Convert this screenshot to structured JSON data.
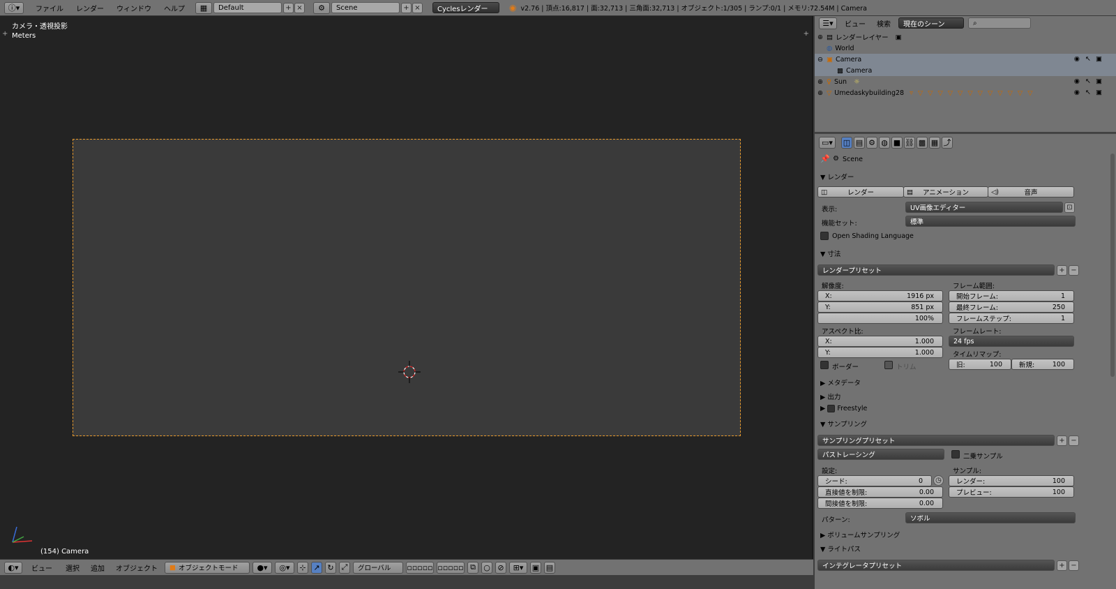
{
  "topbar": {
    "menus": [
      "ファイル",
      "レンダー",
      "ウィンドウ",
      "ヘルプ"
    ],
    "screen_layout": "Default",
    "scene": "Scene",
    "engine": "Cyclesレンダー",
    "stats": "v2.76 | 頂点:16,817 | 面:32,713 | 三角面:32,713 | オブジェクト:1/305 | ランプ:0/1 | メモリ:72.54M | Camera"
  },
  "viewport": {
    "view_name": "カメラ・透視投影",
    "units": "Meters",
    "frame_info": "(154) Camera",
    "menus": [
      "ビュー",
      "選択",
      "追加",
      "オブジェクト"
    ],
    "mode": "オブジェクトモード",
    "orientation": "グローバル",
    "accent": "#e89a2c"
  },
  "outliner": {
    "menus": [
      "ビュー",
      "検索"
    ],
    "display_mode": "現在のシーン",
    "search_placeholder": "",
    "items": [
      {
        "label": "レンダーレイヤー",
        "indent": 0
      },
      {
        "label": "World",
        "indent": 0
      },
      {
        "label": "Camera",
        "indent": 0,
        "selected": true
      },
      {
        "label": "Camera",
        "indent": 1,
        "selected": true
      },
      {
        "label": "Sun",
        "indent": 0
      },
      {
        "label": "Umedaskybuilding28",
        "indent": 0
      }
    ]
  },
  "properties": {
    "context": "Scene",
    "render_panel": {
      "title": "レンダー",
      "buttons": [
        "レンダー",
        "アニメーション",
        "音声"
      ],
      "display_label": "表示:",
      "display_value": "UV画像エディター",
      "featureset_label": "機能セット:",
      "featureset_value": "標準",
      "osl_label": "Open Shading Language"
    },
    "dimensions": {
      "title": "寸法",
      "preset": "レンダープリセット",
      "resolution_label": "解像度:",
      "res_x_label": "X:",
      "res_x": "1916 px",
      "res_y_label": "Y:",
      "res_y": "851 px",
      "res_pct": "100%",
      "aspect_label": "アスペクト比:",
      "asp_x_label": "X:",
      "asp_x": "1.000",
      "asp_y_label": "Y:",
      "asp_y": "1.000",
      "border_label": "ボーダー",
      "crop_label": "トリム",
      "frame_range_label": "フレーム範囲:",
      "start_label": "開始フレーム:",
      "start": "1",
      "end_label": "最終フレーム:",
      "end": "250",
      "step_label": "フレームステップ:",
      "step": "1",
      "framerate_label": "フレームレート:",
      "framerate": "24 fps",
      "remap_label": "タイムリマップ:",
      "old_label": "旧:",
      "old": "100",
      "new_label": "新規:",
      "new": "100"
    },
    "collapsed": [
      "メタデータ",
      "出力",
      "Freestyle"
    ],
    "sampling": {
      "title": "サンプリング",
      "preset": "サンプリングプリセット",
      "method": "パストレーシング",
      "squared_label": "二乗サンプル",
      "settings_label": "設定:",
      "seed_label": "シード:",
      "seed": "0",
      "clamp_direct_label": "直接値を制限:",
      "clamp_direct": "0.00",
      "clamp_indirect_label": "間接値を制限:",
      "clamp_indirect": "0.00",
      "samples_label": "サンプル:",
      "render_label": "レンダー:",
      "render": "100",
      "preview_label": "プレビュー:",
      "preview": "100",
      "pattern_label": "パターン:",
      "pattern": "ソボル"
    },
    "volume_sampling": "ボリュームサンプリング",
    "light_paths": "ライトパス",
    "integrator_preset": "インテグレータプリセット"
  }
}
